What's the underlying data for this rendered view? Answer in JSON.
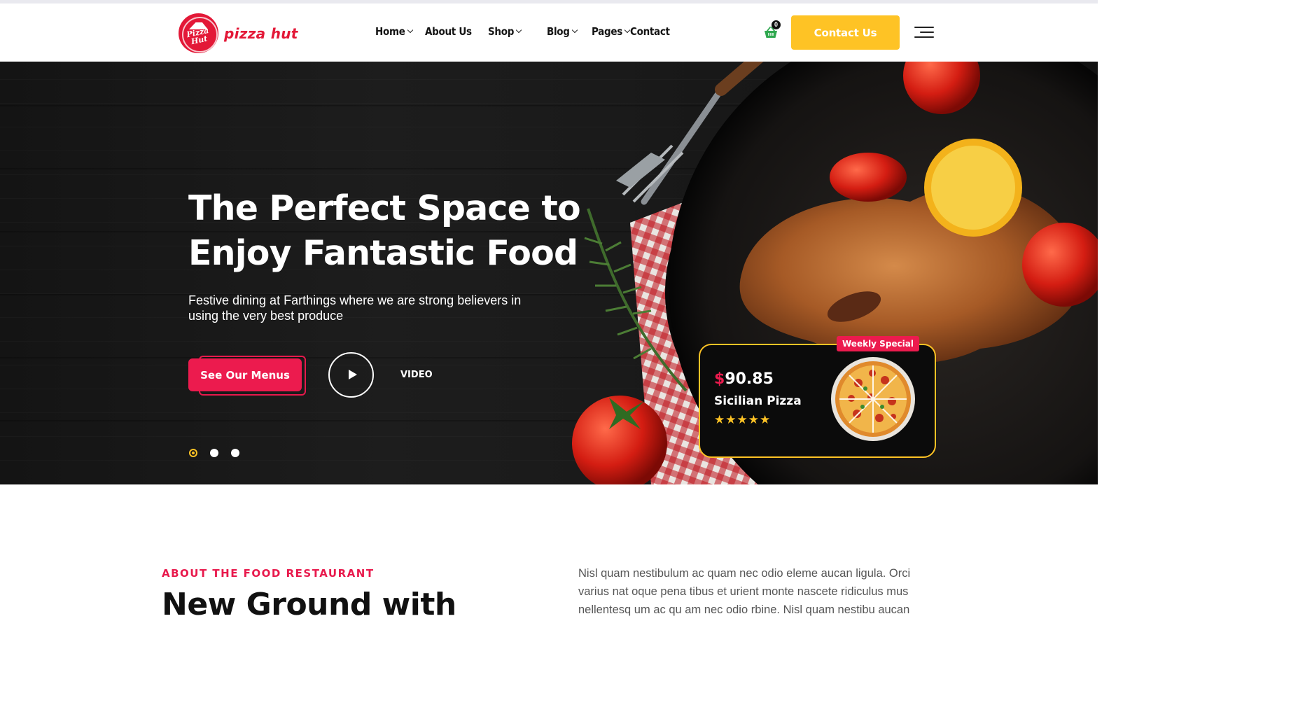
{
  "brand": {
    "name": "pizza hut",
    "badge_text": "Pizza Hut"
  },
  "nav": {
    "items": [
      {
        "label": "Home",
        "dropdown": true
      },
      {
        "label": "About Us",
        "dropdown": false
      },
      {
        "label": "Shop",
        "dropdown": true
      },
      {
        "label": "Blog",
        "dropdown": true
      },
      {
        "label": "Pages",
        "dropdown": true
      },
      {
        "label": "Contact",
        "dropdown": false
      }
    ]
  },
  "header": {
    "cart_count": "0",
    "cart_icon": "basket-icon",
    "contact_button": "Contact Us",
    "menu_icon": "hamburger-menu-icon"
  },
  "hero": {
    "title_line1": "The Perfect Space to",
    "title_line2": "Enjoy Fantastic Food",
    "subtitle": "Festive dining at Farthings where we are strong believers in using the very best produce",
    "menu_button": "See Our Menus",
    "video_label": "VIDEO",
    "slides": {
      "count": 3,
      "active": 1
    }
  },
  "special": {
    "badge": "Weekly Special",
    "currency": "$",
    "price": "90.85",
    "name": "Sicilian Pizza",
    "rating": 5,
    "stars": "★★★★★"
  },
  "about": {
    "eyebrow": "ABOUT THE FOOD RESTAURANT",
    "title": "New Ground with",
    "text": "Nisl quam nestibulum ac quam nec odio eleme aucan ligula. Orci varius nat oque pena tibus et urient monte nascete ridiculus mus nellentesq um ac qu am nec odio rbine. Nisl quam nestibu aucan"
  },
  "colors": {
    "accent_yellow": "#fec325",
    "accent_red": "#ec1b4e",
    "brand_red": "#e31837"
  }
}
